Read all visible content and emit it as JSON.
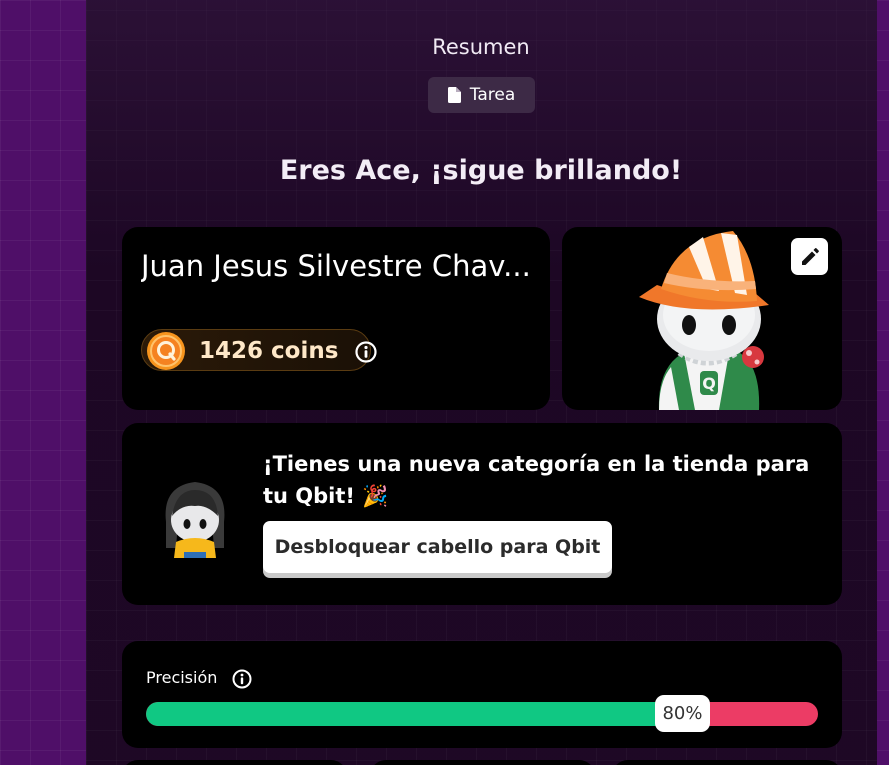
{
  "summary": {
    "title": "Resumen",
    "tag_label": "Tarea",
    "headline": "Eres Ace, ¡sigue brillando!"
  },
  "profile": {
    "name": "Juan Jesus Silvestre Chav...",
    "coins_label": "1426 coins"
  },
  "promo": {
    "message": "¡Tienes una nueva categoría en la tienda para tu Qbit! 🎉",
    "button_label": "Desbloquear cabello para Qbit"
  },
  "accuracy": {
    "label": "Precisión",
    "value_label": "80%",
    "value": 80
  },
  "colors": {
    "correct": "#10c883",
    "incorrect": "#ec3c65",
    "coin": "#f7941d"
  },
  "icons": {
    "tag": "document-icon",
    "coins": "coin-icon",
    "info": "info-icon",
    "edit": "pencil-icon"
  }
}
